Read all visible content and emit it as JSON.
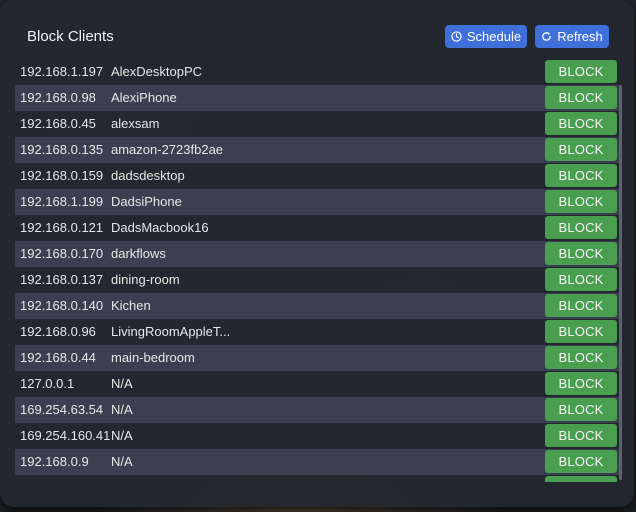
{
  "header": {
    "title": "Block Clients",
    "schedule_label": "Schedule",
    "refresh_label": "Refresh"
  },
  "block_label": "BLOCK",
  "clients": [
    {
      "ip": "192.168.1.197",
      "host": "AlexDesktopPC"
    },
    {
      "ip": "192.168.0.98",
      "host": "AlexiPhone"
    },
    {
      "ip": "192.168.0.45",
      "host": "alexsam"
    },
    {
      "ip": "192.168.0.135",
      "host": "amazon-2723fb2ae"
    },
    {
      "ip": "192.168.0.159",
      "host": "dadsdesktop"
    },
    {
      "ip": "192.168.1.199",
      "host": "DadsiPhone"
    },
    {
      "ip": "192.168.0.121",
      "host": "DadsMacbook16"
    },
    {
      "ip": "192.168.0.170",
      "host": "darkflows"
    },
    {
      "ip": "192.168.0.137",
      "host": "dining-room"
    },
    {
      "ip": "192.168.0.140",
      "host": "Kichen"
    },
    {
      "ip": "192.168.0.96",
      "host": "LivingRoomAppleT..."
    },
    {
      "ip": "192.168.0.44",
      "host": "main-bedroom"
    },
    {
      "ip": "127.0.0.1",
      "host": "N/A"
    },
    {
      "ip": "169.254.63.54",
      "host": "N/A"
    },
    {
      "ip": "169.254.160.41",
      "host": "N/A"
    },
    {
      "ip": "192.168.0.9",
      "host": "N/A"
    }
  ],
  "icons": {
    "schedule": "clock-icon",
    "refresh": "refresh-icon"
  },
  "colors": {
    "primary": "#3f6fd8",
    "block": "#4a9e4f",
    "row_alt": "#3b4050"
  }
}
